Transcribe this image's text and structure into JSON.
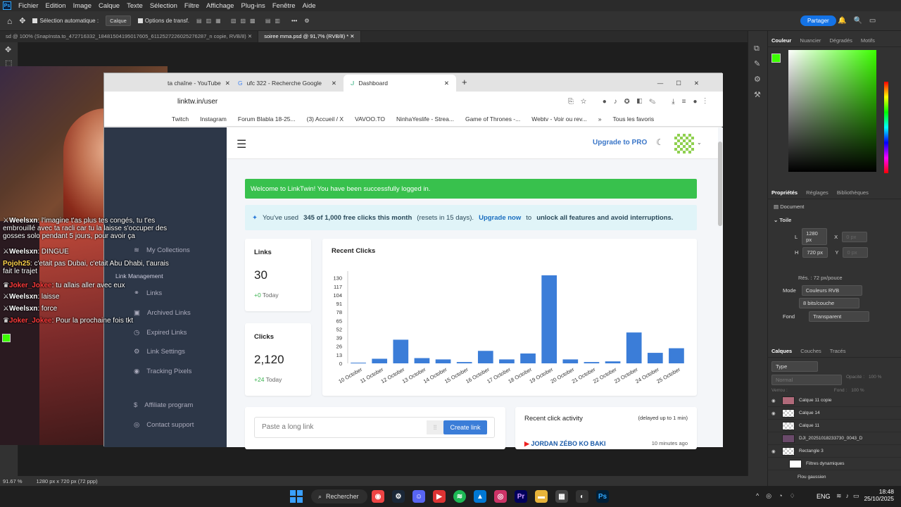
{
  "photoshop": {
    "menu": [
      "Fichier",
      "Edition",
      "Image",
      "Calque",
      "Texte",
      "Sélection",
      "Filtre",
      "Affichage",
      "Plug-ins",
      "Fenêtre",
      "Aide"
    ],
    "options": {
      "auto_select": "Sélection automatique :",
      "select_target": "Calque",
      "transform": "Options de transf.",
      "share": "Partager"
    },
    "doc_tabs": [
      "sd @ 100% (SnapInsta.to_472716332_18481504195017605_6112527226025276287_n copie, RVB/8)",
      "soiree mma.psd @ 91,7% (RVB/8) *"
    ],
    "status": {
      "zoom": "91.67 %",
      "size": "1280 px x 720 px (72 ppp)"
    },
    "panel_tabs_color": [
      "Couleur",
      "Nuancier",
      "Dégradés",
      "Motifs"
    ],
    "panel_tabs_props": [
      "Propriétés",
      "Réglages",
      "Bibliothèques"
    ],
    "properties": {
      "doc_label": "Document",
      "canvas_label": "Toile",
      "w_label": "L",
      "w_value": "1280 px",
      "x_label": "X",
      "x_value": "0 px",
      "h_label": "H",
      "h_value": "720 px",
      "y_label": "Y",
      "y_value": "0 px",
      "res": "Rés. : 72 px/pouce",
      "mode_label": "Mode",
      "mode_value": "Couleurs RVB",
      "bits_value": "8 bits/couche",
      "bg_label": "Fond",
      "bg_value": "Transparent"
    },
    "panel_tabs_layers": [
      "Calques",
      "Couches",
      "Tracés"
    ],
    "layers_filter": "Type",
    "blend": "Normal",
    "opacity_label": "Opacité :",
    "opacity": "100 %",
    "lock_label": "Verrou :",
    "fill_label": "Fond :",
    "fill": "100 %",
    "layers": [
      "Calque 11 copie",
      "Calque 14",
      "Calque 11",
      "DJI_20251018233730_0043_D",
      "Rectangle 3",
      "Filtres dynamiques",
      "Flou gaussien"
    ],
    "colors": {
      "foreground": "#3cff00",
      "background": "#000000"
    }
  },
  "chat": [
    {
      "user": "Weelsxn",
      "color": "#ffffff",
      "text": "l'imagine t'as plus tes congés, tu t'es embrouillé avec ta racli car tu la laisse s'occuper des gosses solo pendant 5 jours, pour avoir ça"
    },
    {
      "user": "Weelsxn",
      "color": "#ffffff",
      "text": "DINGUE"
    },
    {
      "user": "Pojoh25",
      "color": "#ffd34a",
      "text": "c'etait pas Dubai, c'etait Abu Dhabi, t'aurais fait le trajet"
    },
    {
      "user": "Joker_Jokee",
      "color": "#ff3b3b",
      "text": "tu allais aller avec eux"
    },
    {
      "user": "Weelsxn",
      "color": "#ffffff",
      "text": "laisse"
    },
    {
      "user": "Weelsxn",
      "color": "#ffffff",
      "text": "force"
    },
    {
      "user": "Joker_Jokee",
      "color": "#ff3b3b",
      "text": "Pour la prochaine fois tkt"
    }
  ],
  "browser": {
    "tabs": [
      "ta chaîne - YouTube",
      "ufc 322 - Recherche Google",
      "Dashboard"
    ],
    "url": "linktw.in/user",
    "bookmarks": [
      "Twitch",
      "Instagram",
      "Forum Blabla 18-25...",
      "(3) Accueil / X",
      "VAVOO.TO",
      "NinhaYeslife - Strea...",
      "Game of Thrones -...",
      "Webtv - Voir ou rev..."
    ],
    "all_bookmarks": "Tous les favoris"
  },
  "linktwin": {
    "sidebar": {
      "collections": "My Collections",
      "section": "Link Management",
      "items": [
        "Links",
        "Archived Links",
        "Expired Links",
        "Link Settings",
        "Tracking Pixels"
      ],
      "affiliate": "Affiliate program",
      "support": "Contact support",
      "extra": "Collections"
    },
    "upgrade_pro": "Upgrade to PRO",
    "welcome": "Welcome to LinkTwin! You have been successfully logged in.",
    "usage": {
      "prefix": "You've used",
      "count": "345 of 1,000 free clicks this month",
      "resets": "(resets in 15 days).",
      "upgrade": "Upgrade now",
      "to": "to",
      "unlock": "unlock all features and avoid interruptions."
    },
    "links_card": {
      "title": "Links",
      "value": "30",
      "delta": "+0",
      "delta_label": "Today"
    },
    "clicks_card": {
      "title": "Clicks",
      "value": "2,120",
      "delta": "+24",
      "delta_label": "Today"
    },
    "recent_clicks_title": "Recent Clicks",
    "paste_placeholder": "Paste a long link",
    "create_link": "Create link",
    "activity": {
      "title": "Recent click activity",
      "note": "(delayed up to 1 min)",
      "item": "JORDAN ZÉBO KO BAKI",
      "time": "10 minutes ago"
    }
  },
  "chart_data": {
    "type": "bar",
    "title": "Recent Clicks",
    "categories": [
      "10 October",
      "11 October",
      "12 October",
      "13 October",
      "14 October",
      "15 October",
      "16 October",
      "17 October",
      "18 October",
      "19 October",
      "20 October",
      "21 October",
      "22 October",
      "23 October",
      "24 October",
      "25 October"
    ],
    "values": [
      1,
      7,
      36,
      8,
      6,
      2,
      19,
      6,
      15,
      134,
      6,
      2,
      3,
      47,
      16,
      23
    ],
    "yticks": [
      0,
      13,
      26,
      39,
      52,
      65,
      78,
      91,
      104,
      117,
      130
    ],
    "ylim": [
      0,
      134
    ],
    "color": "#3b7dd8",
    "grid": false
  },
  "taskbar": {
    "search": "Rechercher",
    "lang": "ENG",
    "time": "18:48",
    "date": "25/10/2025"
  }
}
